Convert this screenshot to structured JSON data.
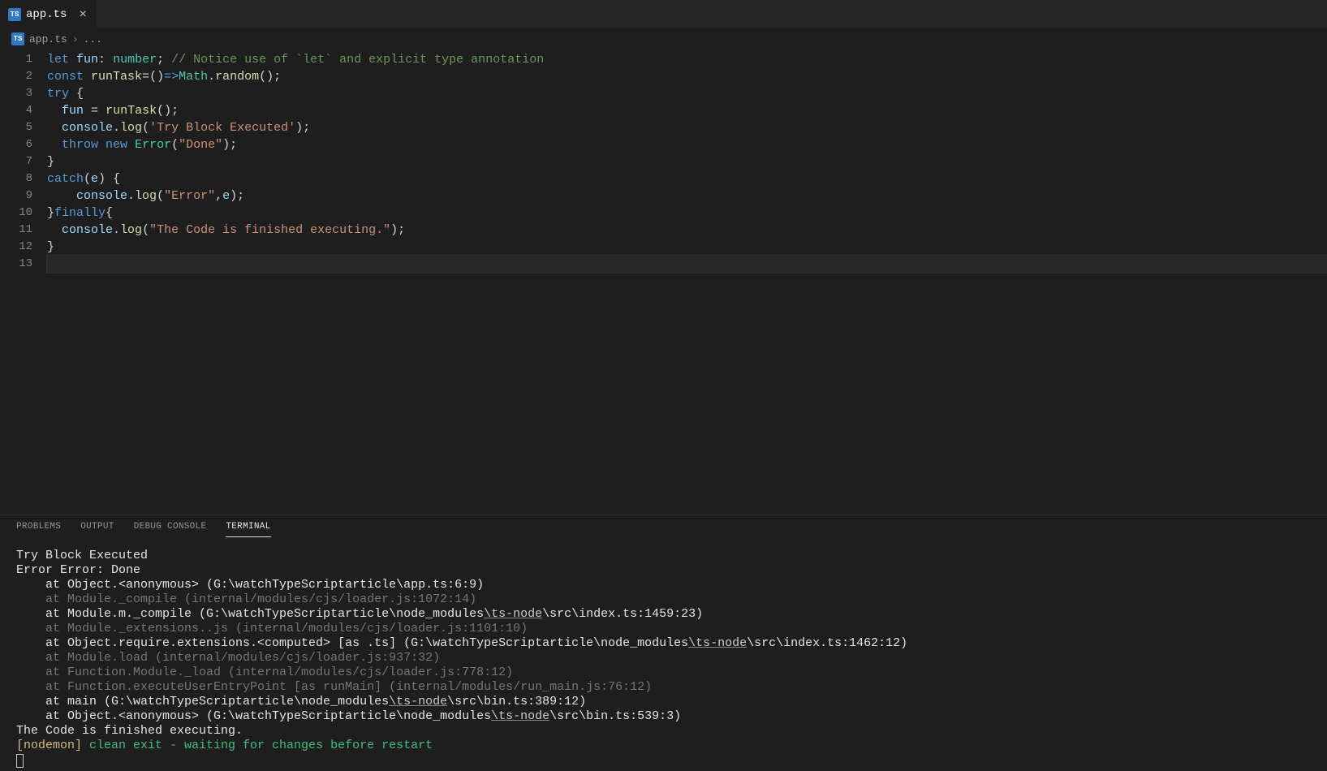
{
  "tabs": {
    "active": {
      "icon": "TS",
      "label": "app.ts"
    }
  },
  "breadcrumb": {
    "icon": "TS",
    "file": "app.ts",
    "sep": "›",
    "trail": "..."
  },
  "editor": {
    "lines_count": 13,
    "code": [
      [
        [
          "kw",
          "let"
        ],
        [
          "pln",
          " "
        ],
        [
          "var",
          "fun"
        ],
        [
          "pnc",
          ":"
        ],
        [
          "pln",
          " "
        ],
        [
          "cls",
          "number"
        ],
        [
          "pnc",
          ";"
        ],
        [
          "pln",
          " "
        ],
        [
          "cmt",
          "// Notice use of `let` and explicit type annotation"
        ]
      ],
      [
        [
          "kw",
          "const"
        ],
        [
          "pln",
          " "
        ],
        [
          "fn",
          "runTask"
        ],
        [
          "pnc",
          "="
        ],
        [
          "pnc",
          "()"
        ],
        [
          "kw",
          "=>"
        ],
        [
          "cls",
          "Math"
        ],
        [
          "pnc",
          "."
        ],
        [
          "fn",
          "random"
        ],
        [
          "pnc",
          "();"
        ]
      ],
      [
        [
          "kw",
          "try"
        ],
        [
          "pln",
          " "
        ],
        [
          "pnc",
          "{"
        ]
      ],
      [
        [
          "pln",
          "  "
        ],
        [
          "var",
          "fun"
        ],
        [
          "pln",
          " "
        ],
        [
          "pnc",
          "="
        ],
        [
          "pln",
          " "
        ],
        [
          "fn",
          "runTask"
        ],
        [
          "pnc",
          "();"
        ]
      ],
      [
        [
          "pln",
          "  "
        ],
        [
          "var",
          "console"
        ],
        [
          "pnc",
          "."
        ],
        [
          "fn",
          "log"
        ],
        [
          "pnc",
          "("
        ],
        [
          "str",
          "'Try Block Executed'"
        ],
        [
          "pnc",
          ");"
        ]
      ],
      [
        [
          "pln",
          "  "
        ],
        [
          "kw",
          "throw"
        ],
        [
          "pln",
          " "
        ],
        [
          "kw",
          "new"
        ],
        [
          "pln",
          " "
        ],
        [
          "cls",
          "Error"
        ],
        [
          "pnc",
          "("
        ],
        [
          "str",
          "\"Done\""
        ],
        [
          "pnc",
          ");"
        ]
      ],
      [
        [
          "pnc",
          "}"
        ]
      ],
      [
        [
          "kw",
          "catch"
        ],
        [
          "pnc",
          "("
        ],
        [
          "var",
          "e"
        ],
        [
          "pnc",
          ")"
        ],
        [
          "pln",
          " "
        ],
        [
          "pnc",
          "{"
        ]
      ],
      [
        [
          "pln",
          "    "
        ],
        [
          "var",
          "console"
        ],
        [
          "pnc",
          "."
        ],
        [
          "fn",
          "log"
        ],
        [
          "pnc",
          "("
        ],
        [
          "str",
          "\"Error\""
        ],
        [
          "pnc",
          ","
        ],
        [
          "var",
          "e"
        ],
        [
          "pnc",
          ");"
        ]
      ],
      [
        [
          "pnc",
          "}"
        ],
        [
          "kw",
          "finally"
        ],
        [
          "pnc",
          "{"
        ]
      ],
      [
        [
          "pln",
          "  "
        ],
        [
          "var",
          "console"
        ],
        [
          "pnc",
          "."
        ],
        [
          "fn",
          "log"
        ],
        [
          "pnc",
          "("
        ],
        [
          "str",
          "\"The Code is finished executing.\""
        ],
        [
          "pnc",
          ");"
        ]
      ],
      [
        [
          "pnc",
          "}"
        ]
      ],
      [
        [
          "pln",
          ""
        ]
      ]
    ]
  },
  "panel": {
    "tabs": [
      "PROBLEMS",
      "OUTPUT",
      "DEBUG CONSOLE",
      "TERMINAL"
    ],
    "active": "TERMINAL",
    "terminal": [
      {
        "cls": "tl-white",
        "segs": [
          [
            "",
            "Try Block Executed"
          ]
        ]
      },
      {
        "cls": "tl-white",
        "segs": [
          [
            "",
            "Error Error: Done"
          ]
        ]
      },
      {
        "cls": "tl-white",
        "segs": [
          [
            "",
            "    at Object.<anonymous> (G:\\watchTypeScriptarticle\\app.ts:6:9)"
          ]
        ]
      },
      {
        "cls": "tl-dim",
        "segs": [
          [
            "",
            "    at Module._compile (internal/modules/cjs/loader.js:1072:14)"
          ]
        ]
      },
      {
        "cls": "tl-white",
        "segs": [
          [
            "",
            "    at Module.m._compile (G:\\watchTypeScriptarticle\\node_modules"
          ],
          [
            "tl-link",
            "\\ts-node"
          ],
          [
            "",
            "\\src\\index.ts:1459:23)"
          ]
        ]
      },
      {
        "cls": "tl-dim",
        "segs": [
          [
            "",
            "    at Module._extensions..js (internal/modules/cjs/loader.js:1101:10)"
          ]
        ]
      },
      {
        "cls": "tl-white",
        "segs": [
          [
            "",
            "    at Object.require.extensions.<computed> [as .ts] (G:\\watchTypeScriptarticle\\node_modules"
          ],
          [
            "tl-link",
            "\\ts-node"
          ],
          [
            "",
            "\\src\\index.ts:1462:12)"
          ]
        ]
      },
      {
        "cls": "tl-dim",
        "segs": [
          [
            "",
            "    at Module.load (internal/modules/cjs/loader.js:937:32)"
          ]
        ]
      },
      {
        "cls": "tl-dim",
        "segs": [
          [
            "",
            "    at Function.Module._load (internal/modules/cjs/loader.js:778:12)"
          ]
        ]
      },
      {
        "cls": "tl-dim",
        "segs": [
          [
            "",
            "    at Function.executeUserEntryPoint [as runMain] (internal/modules/run_main.js:76:12)"
          ]
        ]
      },
      {
        "cls": "tl-white",
        "segs": [
          [
            "",
            "    at main (G:\\watchTypeScriptarticle\\node_modules"
          ],
          [
            "tl-link",
            "\\ts-node"
          ],
          [
            "",
            "\\src\\bin.ts:389:12)"
          ]
        ]
      },
      {
        "cls": "tl-white",
        "segs": [
          [
            "",
            "    at Object.<anonymous> (G:\\watchTypeScriptarticle\\node_modules"
          ],
          [
            "tl-link",
            "\\ts-node"
          ],
          [
            "",
            "\\src\\bin.ts:539:3)"
          ]
        ]
      },
      {
        "cls": "tl-white",
        "segs": [
          [
            "",
            "The Code is finished executing."
          ]
        ]
      },
      {
        "cls": "tl-yellow",
        "segs": [
          [
            "",
            "[nodemon]"
          ],
          [
            "tl-green",
            " clean exit - waiting for changes before restart"
          ]
        ]
      }
    ]
  }
}
